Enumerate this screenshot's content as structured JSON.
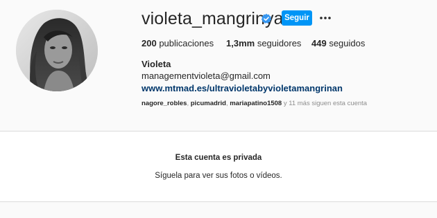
{
  "profile": {
    "username": "violeta_mangrinyan",
    "verified_icon": "verified-badge-icon",
    "follow_label": "Seguir",
    "more_icon": "more-options-icon",
    "avatar_icon": "profile-avatar",
    "stats": {
      "posts_count": "200",
      "posts_label": "publicaciones",
      "followers_count": "1,3mm",
      "followers_label": "seguidores",
      "following_count": "449",
      "following_label": "seguidos"
    },
    "full_name": "Violeta",
    "bio_email": "managementvioleta@gmail.com",
    "bio_link": "www.mtmad.es/ultravioletabyvioletamangrinan",
    "followed_by": {
      "users": [
        "nagore_robles",
        "picumadrid",
        "mariapatino1508"
      ],
      "separator": ",",
      "more_text": "y 11 más siguen esta cuenta"
    }
  },
  "private_notice": {
    "title": "Esta cuenta es privada",
    "subtitle": "Síguela para ver sus fotos o vídeos."
  },
  "colors": {
    "accent": "#0095f6",
    "link": "#00376b",
    "secondary_text": "#8e8e8e",
    "page_background": "#fafafa"
  }
}
